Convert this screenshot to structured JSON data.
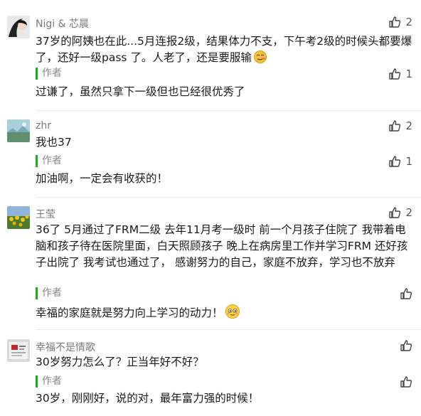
{
  "comments": [
    {
      "nickname": "Nigi & 芯晨",
      "likes": "2",
      "text": "37岁的阿姨也在此...5月连报2级，结果体力不支，下午考2级的时候头都要爆了，还好一级pass 了。人老了，还是要服输",
      "emoji": "smirk-emoji",
      "reply_tag": "作者",
      "reply_likes": "1",
      "reply_text": "过谦了，虽然只拿下一级但也已经很优秀了"
    },
    {
      "nickname": "zhr",
      "likes": "2",
      "text": "我也37",
      "reply_tag": "作者",
      "reply_likes": "1",
      "reply_text": "加油啊，一定会有收获的！"
    },
    {
      "nickname": "王莹",
      "likes": "2",
      "text": "36了 5月通过了FRM二级 去年11月考一级时 前一个月孩子住院了 我带着电脑和孩子待在医院里面，白天照顾孩子 晚上在病房里工作并学习FRM 还好孩子出院了 我考试也通过了，  感谢努力的自己，家庭不放弃，学习也不放弃",
      "reply_tag": "作者",
      "reply_text": "幸福的家庭就是努力向上学习的动力！",
      "reply_emoji": "smile-emoji"
    },
    {
      "nickname": "幸福不是情歌",
      "text": "30岁努力怎么了？正当年好不好？",
      "reply_tag": "作者",
      "reply_text": "30岁，刚刚好，说的对，最年富力强的时候！"
    }
  ],
  "colors": {
    "author_accent": "#1aad19",
    "muted": "#7a7a7a",
    "text": "#1a1a1a"
  }
}
